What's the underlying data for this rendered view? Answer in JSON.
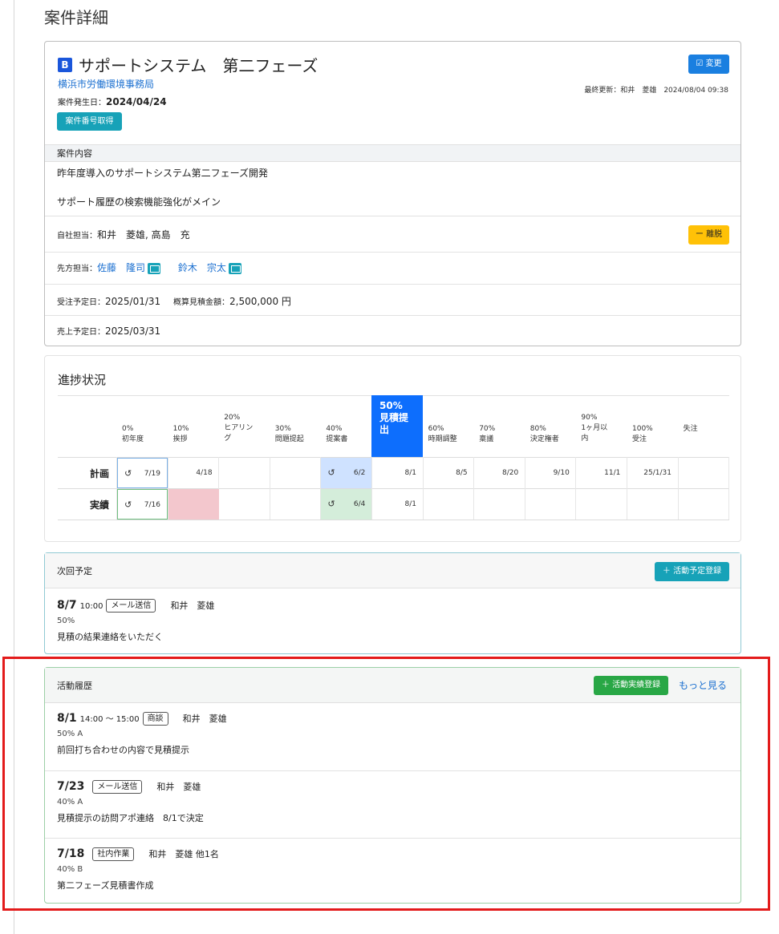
{
  "page_title": "案件詳細",
  "case": {
    "rank": "B",
    "title": "サポートシステム　第二フェーズ",
    "client": "横浜市労働環境事務局",
    "occurrence_label": "案件発生日：",
    "occurrence_date": "2024/04/24",
    "number_button": "案件番号取得",
    "edit_button": "☑ 変更",
    "last_updated": "最終更新：和井　菱雄　2024/08/04 09:38"
  },
  "content": {
    "section_label": "案件内容",
    "line1": "昨年度導入のサポートシステム第二フェーズ開発",
    "line2": "サポート履歴の検索機能強化がメイン"
  },
  "own_staff": {
    "label": "自社担当：",
    "names": "和井　菱雄, 高島　充",
    "leave_button": "ー 離脱"
  },
  "client_staff": {
    "label": "先方担当：",
    "person1": "佐藤　隆司",
    "person2": "鈴木　宗太"
  },
  "order": {
    "label": "受注予定日：",
    "date": "2025/01/31",
    "amount_label": "概算見積金額：",
    "amount": "2,500,000 円"
  },
  "sales": {
    "label": "売上予定日：",
    "date": "2025/03/31"
  },
  "progress": {
    "title": "進捗状況",
    "stages": [
      {
        "pct": "0%",
        "name": "初年度"
      },
      {
        "pct": "10%",
        "name": "挨拶"
      },
      {
        "pct": "20%",
        "name": "ヒアリン\nグ"
      },
      {
        "pct": "30%",
        "name": "問題提起"
      },
      {
        "pct": "40%",
        "name": "提案書"
      },
      {
        "pct": "50%",
        "name": "見積提\n出"
      },
      {
        "pct": "60%",
        "name": "時期調整"
      },
      {
        "pct": "70%",
        "name": "稟議"
      },
      {
        "pct": "80%",
        "name": "決定権者"
      },
      {
        "pct": "90%",
        "name": "1ヶ月以\n内"
      },
      {
        "pct": "100%",
        "name": "受注"
      },
      {
        "pct": "",
        "name": "失注"
      }
    ],
    "active_stage_label": "50%\n見積提\n出",
    "plan_label": "計画",
    "actual_label": "実績",
    "plan": [
      "7/19",
      "4/18",
      "",
      "",
      "6/2",
      "8/1",
      "8/5",
      "8/20",
      "9/10",
      "11/1",
      "25/1/31",
      ""
    ],
    "actual": [
      "7/16",
      "",
      "",
      "",
      "6/4",
      "8/1",
      "",
      "",
      "",
      "",
      "",
      ""
    ],
    "history_icon": "↺"
  },
  "next": {
    "title": "次回予定",
    "button": "＋ 活動予定登録",
    "date": "8/7",
    "time": "10:00",
    "tag": "メール送信",
    "user": "和井　菱雄",
    "percent": "50%",
    "note": "見積の結果連絡をいただく"
  },
  "history": {
    "title": "活動履歴",
    "button": "＋ 活動実績登録",
    "more": "もっと見る",
    "items": [
      {
        "date": "8/1",
        "time": "14:00 ～ 15:00",
        "tag": "商談",
        "user": "和井　菱雄",
        "sub": "50%  A",
        "note": "前回打ち合わせの内容で見積提示"
      },
      {
        "date": "7/23",
        "time": "",
        "tag": "メール送信",
        "user": "和井　菱雄",
        "sub": "40%  A",
        "note": "見積提示の訪問アポ連絡　8/1で決定"
      },
      {
        "date": "7/18",
        "time": "",
        "tag": "社内作業",
        "user": "和井　菱雄 他1名",
        "sub": "40%  B",
        "note": "第二フェーズ見積書作成"
      }
    ]
  },
  "colors": {
    "primary": "#0d6efd",
    "info": "#17a2b8",
    "success": "#28a745",
    "warning": "#ffc107",
    "plan_highlight": "#cfe2ff",
    "actual_highlight": "#d4edda",
    "delay": "#f3c7cd",
    "annotation_border": "#e31b1b"
  }
}
